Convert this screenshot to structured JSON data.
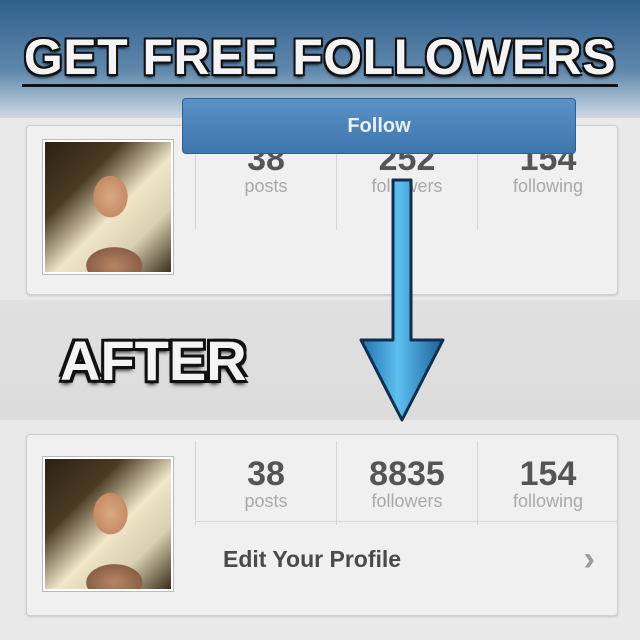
{
  "banner": {
    "title": "GET FREE FOLLOWERS"
  },
  "overlay": {
    "after_label": "AFTER"
  },
  "before": {
    "stats": [
      {
        "value": "38",
        "label": "posts"
      },
      {
        "value": "252",
        "label": "followers"
      },
      {
        "value": "154",
        "label": "following"
      }
    ],
    "follow_label": "Follow"
  },
  "after": {
    "stats": [
      {
        "value": "38",
        "label": "posts"
      },
      {
        "value": "8835",
        "label": "followers"
      },
      {
        "value": "154",
        "label": "following"
      }
    ],
    "edit_profile_label": "Edit Your Profile"
  },
  "colors": {
    "accent": "#3e76ae",
    "arrow": "#3aa0d8"
  },
  "icons": {
    "arrow": "down-arrow-icon",
    "chevron": "chevron-right-icon"
  }
}
